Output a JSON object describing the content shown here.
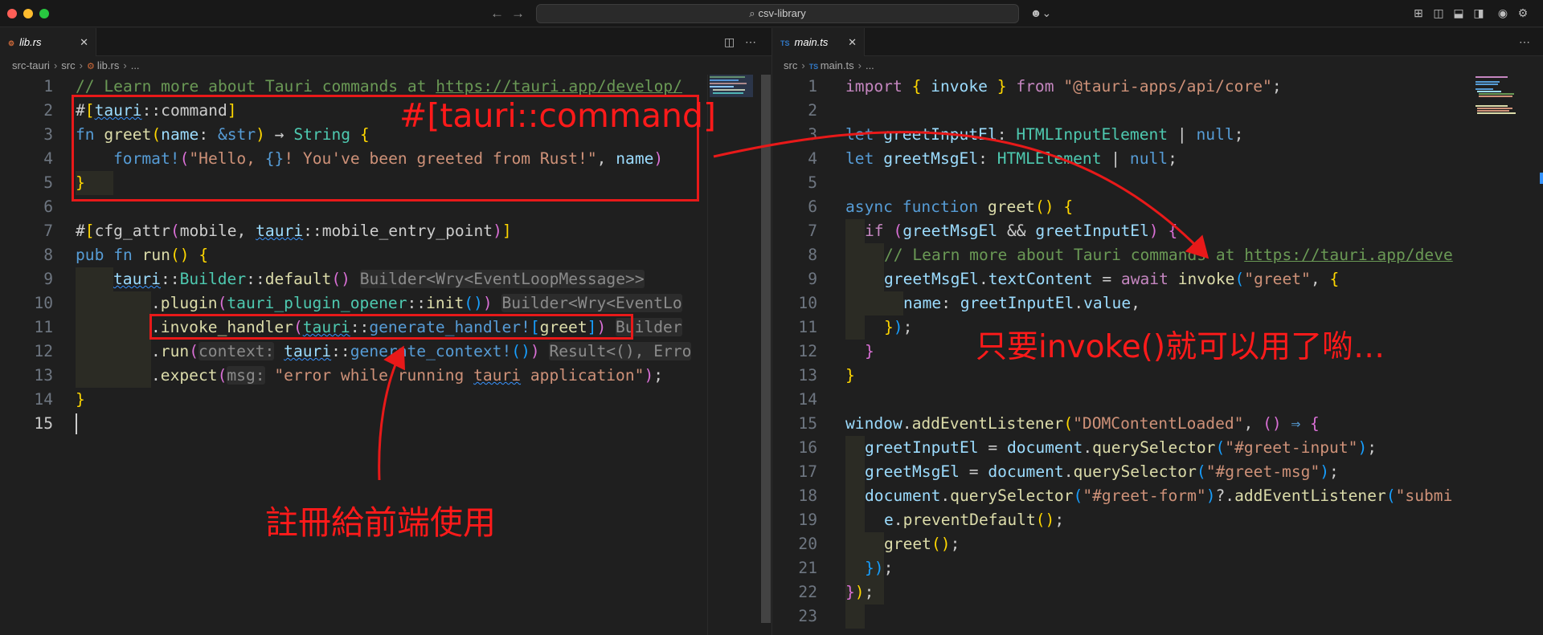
{
  "window": {
    "search_text": "csv-library",
    "traffic_colors": [
      "#ff5f57",
      "#febc2e",
      "#28c840"
    ]
  },
  "left_editor": {
    "tab_label": "lib.rs",
    "breadcrumb": [
      "src-tauri",
      "src",
      "lib.rs",
      "..."
    ],
    "line_numbers": [
      "1",
      "2",
      "3",
      "4",
      "5",
      "6",
      "7",
      "8",
      "9",
      "10",
      "11",
      "12",
      "13",
      "14",
      "15"
    ],
    "tokens": {
      "l1_comment": "// Learn more about Tauri commands at ",
      "l1_url": "https://tauri.app/develop/",
      "attr_hash": "#",
      "tauri": "tauri",
      "colons": "::",
      "command": "command",
      "fn": "fn",
      "greet": "greet",
      "name": "name",
      "amp_str": "&str",
      "arrow": "→",
      "string_ty": "String",
      "format_macro": "format!",
      "format_str1": "\"Hello, ",
      "format_braces": "{}",
      "format_str2": "! You've been greeted from Rust!\"",
      "cfg_attr": "cfg_attr",
      "mobile": "mobile",
      "mobile_entry_point": "mobile_entry_point",
      "pub": "pub",
      "run": "run",
      "builder": "Builder",
      "default": "default",
      "hint_builder": "Builder<Wry<EventLoopMessage>>",
      "plugin": "plugin",
      "tauri_plugin_opener": "tauri_plugin_opener",
      "init": "init",
      "hint_builder_cut": "Builder<Wry<EventLo",
      "invoke_handler": "invoke_handler",
      "generate_handler": "generate_handler!",
      "hint_builder_short": "Builder",
      "run_method": "run",
      "context_hint": "context:",
      "generate_context": "generate_context!",
      "hint_result": "Result<(), Erro",
      "expect": "expect",
      "msg_hint": "msg:",
      "error_str1": "\"error while running ",
      "error_str_tauri": "tauri",
      "error_str2": " application\""
    }
  },
  "right_editor": {
    "tab_label": "main.ts",
    "breadcrumb": [
      "src",
      "main.ts",
      "..."
    ],
    "line_numbers": [
      "1",
      "2",
      "3",
      "4",
      "5",
      "6",
      "7",
      "8",
      "9",
      "10",
      "11",
      "12",
      "13",
      "14",
      "15",
      "16",
      "17",
      "18",
      "19",
      "20",
      "21",
      "22",
      "23"
    ],
    "tokens": {
      "import": "import",
      "invoke": "invoke",
      "from": "from",
      "pkg_str": "\"@tauri-apps/api/core\"",
      "let": "let",
      "greetInputEl": "greetInputEl",
      "greetMsgEl": "greetMsgEl",
      "html_input_el": "HTMLInputElement",
      "html_el": "HTMLElement",
      "null": "null",
      "async": "async",
      "function": "function",
      "greet": "greet",
      "if": "if",
      "and": "&&",
      "comment": "// Learn more about Tauri commands at ",
      "comment_url": "https://tauri.app/deve",
      "textContent": "textContent",
      "await": "await",
      "greet_str": "\"greet\"",
      "name": "name",
      "value": "value",
      "window": "window",
      "addEventListener": "addEventListener",
      "dom_loaded": "\"DOMContentLoaded\"",
      "arrow": "⇒",
      "document": "document",
      "querySelector": "querySelector",
      "greet_input_sel": "\"#greet-input\"",
      "greet_msg_sel": "\"#greet-msg\"",
      "greet_form_sel": "\"#greet-form\"",
      "submit_cut": "\"submi",
      "e": "e",
      "preventDefault": "preventDefault"
    }
  },
  "annotations": {
    "command_label": "#[tauri::command]",
    "register_label": "註冊給前端使用",
    "invoke_label": "只要invoke()就可以用了喲…",
    "color": "#e81919"
  }
}
